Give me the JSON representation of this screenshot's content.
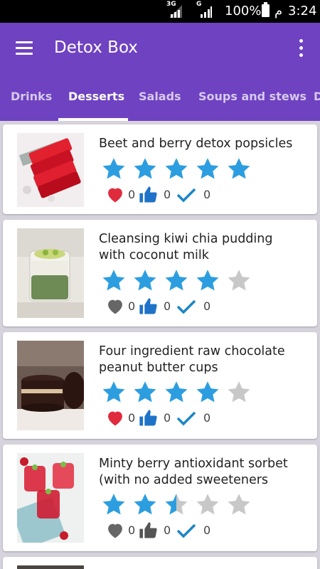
{
  "status_bar": {
    "network1": "3G",
    "network2": "G",
    "battery": "100%",
    "period": "م",
    "time": "3:24"
  },
  "app_bar": {
    "title": "Detox Box"
  },
  "tabs": [
    {
      "label": "Drinks"
    },
    {
      "label": "Desserts"
    },
    {
      "label": "Salads"
    },
    {
      "label": "Soups and stews"
    },
    {
      "label": "D"
    }
  ],
  "active_tab": "Desserts",
  "colors": {
    "primary": "#6f42c1",
    "star_filled": "#2c9ee0",
    "star_empty": "#c8c8c8",
    "heart_active": "#e02b3d",
    "heart_inactive": "#666666",
    "like_active": "#1e73c8",
    "like_inactive": "#555555",
    "check": "#1b86c6"
  },
  "recipes": [
    {
      "title_line1": "Beet and berry detox popsicles",
      "title_line2": "",
      "rating": 5,
      "favorite": true,
      "liked": true,
      "favorites_count": "0",
      "likes_count": "0",
      "done_count": "0",
      "image_icon": "red-popsicles-image"
    },
    {
      "title_line1": "Cleansing kiwi chia pudding",
      "title_line2": "with coconut milk",
      "rating": 4,
      "favorite": false,
      "liked": true,
      "favorites_count": "0",
      "likes_count": "0",
      "done_count": "0",
      "image_icon": "kiwi-pudding-jar-image"
    },
    {
      "title_line1": "Four ingredient raw chocolate",
      "title_line2": "peanut butter cups",
      "rating": 4,
      "favorite": true,
      "liked": true,
      "favorites_count": "0",
      "likes_count": "0",
      "done_count": "0",
      "image_icon": "chocolate-cups-image"
    },
    {
      "title_line1": "Minty berry antioxidant sorbet",
      "title_line2": "(with no added sweeteners",
      "rating": 2.5,
      "favorite": false,
      "liked": false,
      "favorites_count": "0",
      "likes_count": "0",
      "done_count": "0",
      "image_icon": "berry-sorbet-glasses-image"
    }
  ]
}
